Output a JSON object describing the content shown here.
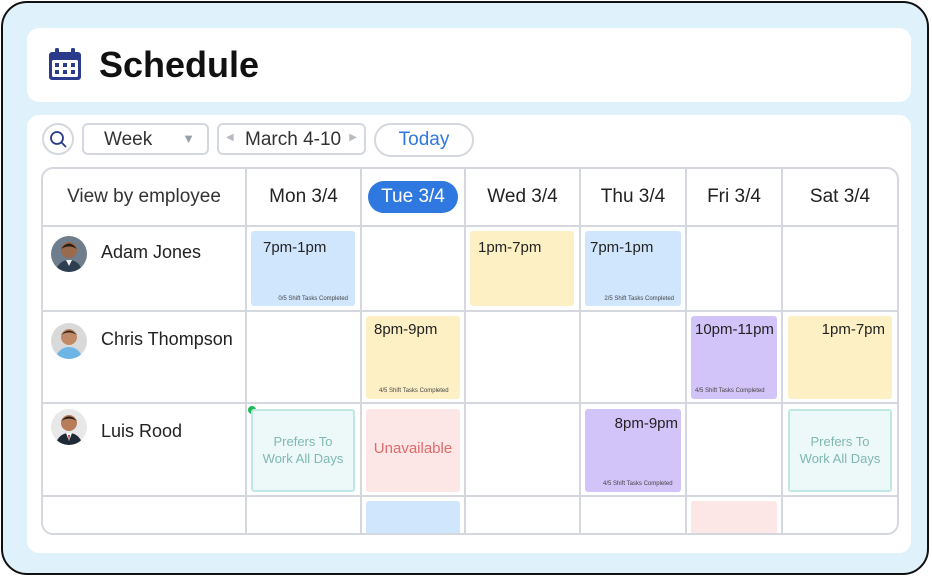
{
  "header": {
    "title": "Schedule",
    "icon": "calendar-icon"
  },
  "toolbar": {
    "search_icon": "search-icon",
    "view_select_value": "Week",
    "date_range": "March 4-10",
    "today_label": "Today"
  },
  "grid": {
    "view_label": "View by employee",
    "days": [
      "Mon 3/4",
      "Tue 3/4",
      "Wed 3/4",
      "Thu 3/4",
      "Fri 3/4",
      "Sat 3/4"
    ],
    "today_day": "Tue 3/4",
    "employees": [
      {
        "name": "Adam Jones",
        "shifts": [
          {
            "day": "Mon 3/4",
            "time": "7pm-1pm",
            "tasks": "0/5 Shift Tasks Completed",
            "color": "#cfe6fd"
          },
          {
            "day": "Wed 3/4",
            "time": "1pm-7pm",
            "tasks": "",
            "color": "#fdf0c4"
          },
          {
            "day": "Thu 3/4",
            "time": "7pm-1pm",
            "tasks": "2/5 Shift Tasks Completed",
            "color": "#cfe6fd"
          }
        ]
      },
      {
        "name": "Chris Thompson",
        "shifts": [
          {
            "day": "Tue 3/4",
            "time": "8pm-9pm",
            "tasks": "4/5 Shift Tasks Completed",
            "color": "#fdf0c4"
          },
          {
            "day": "Fri 3/4",
            "time": "10pm-11pm",
            "tasks": "4/5 Shift Tasks Completed",
            "color": "#d2c4f8"
          },
          {
            "day": "Sat 3/4",
            "time": "1pm-7pm",
            "tasks": "",
            "color": "#fdf0c4"
          }
        ]
      },
      {
        "name": "Luis Rood",
        "shifts": [
          {
            "day": "Mon 3/4",
            "note_line1": "Prefers To",
            "note_line2": "Work All Days"
          },
          {
            "day": "Tue 3/4",
            "note": "Unavailable",
            "color": "#e06b6b"
          },
          {
            "day": "Thu 3/4",
            "time": "8pm-9pm",
            "tasks": "4/5 Shift Tasks Completed",
            "color": "#d2c4f8"
          },
          {
            "day": "Sat 3/4",
            "note_line1": "Prefers To",
            "note_line2": "Work All Days"
          }
        ]
      }
    ]
  }
}
